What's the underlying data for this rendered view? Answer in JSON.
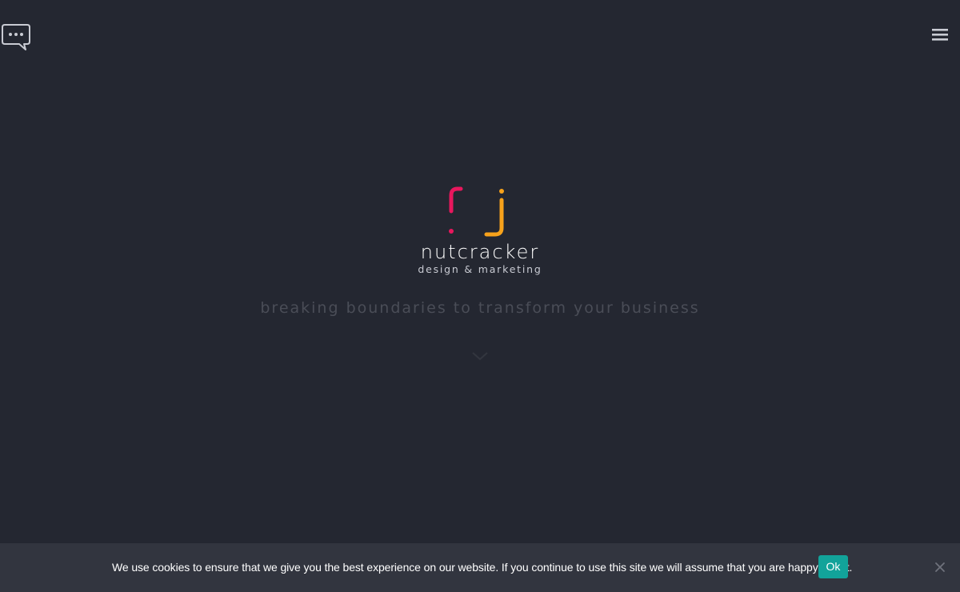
{
  "header": {
    "chat_icon": "speech-bubble-dots-icon",
    "menu_icon": "hamburger-menu-icon"
  },
  "hero": {
    "logo": {
      "name": "nutcracker",
      "subtitle": "design & marketing",
      "mark_colors": {
        "left": "#e8175d",
        "right": "#f7a21b"
      }
    },
    "tagline": "breaking boundaries to transform your business",
    "scroll_icon": "chevron-down-icon"
  },
  "cookie_notice": {
    "message": "We use cookies to ensure that we give you the best experience on our website. If you continue to use this site we will assume that you are happy with it.",
    "ok_label": "Ok",
    "close_icon": "close-icon"
  },
  "colors": {
    "background": "#242731",
    "cookie_bar": "#32353f",
    "accent": "#12a39a"
  }
}
